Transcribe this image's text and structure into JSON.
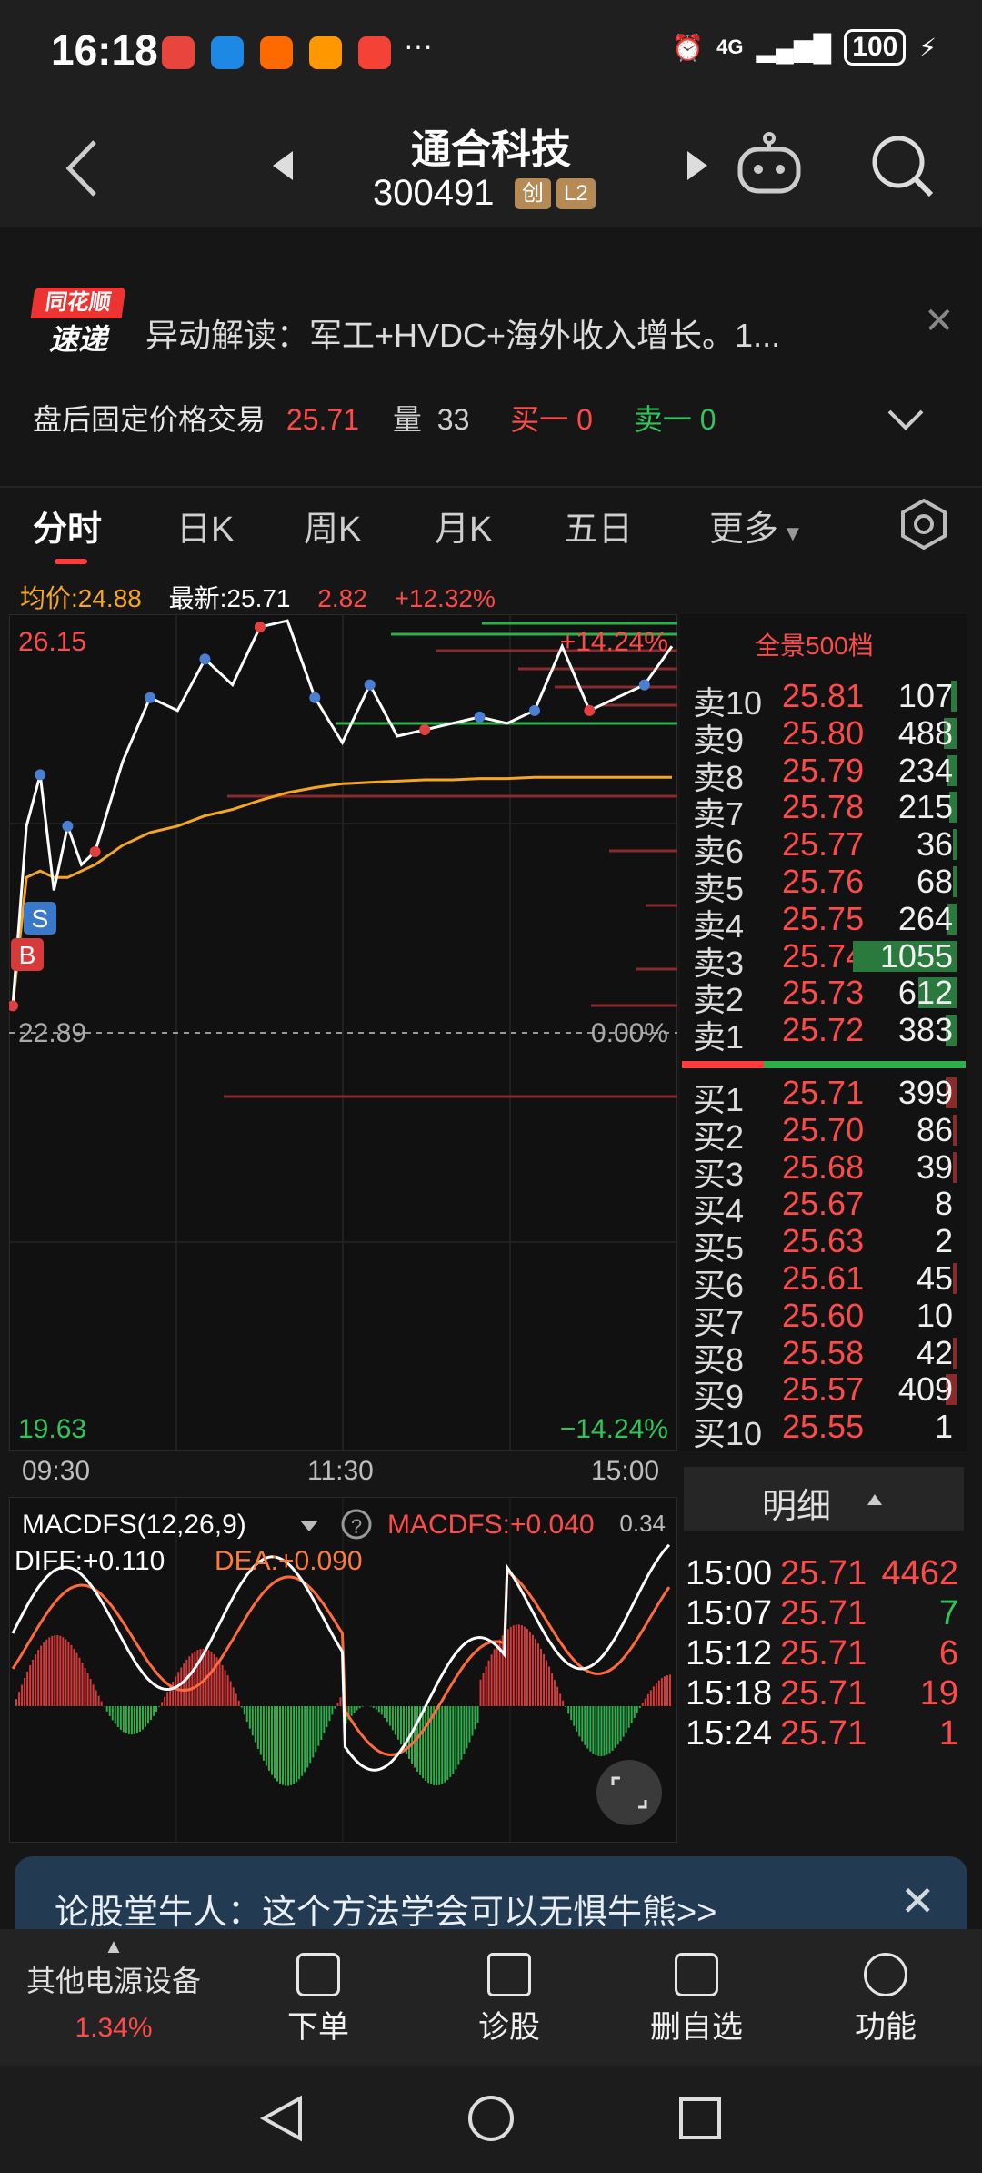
{
  "status": {
    "time": "16:18",
    "network": "4G",
    "battery": "100",
    "more": "···"
  },
  "header": {
    "name": "通合科技",
    "code": "300491",
    "tag1": "创",
    "tag2": "L2"
  },
  "news": {
    "logo_top": "同花顺",
    "logo_bottom": "速递",
    "text": "异动解读：军工+HVDC+海外收入增长。1..."
  },
  "after_hours": {
    "label": "盘后固定价格交易",
    "price": "25.71",
    "vol_label": "量",
    "vol": "33",
    "buy1": "买一 0",
    "sell1": "卖一 0"
  },
  "tabs": [
    {
      "label": "分时"
    },
    {
      "label": "日K"
    },
    {
      "label": "周K"
    },
    {
      "label": "月K"
    },
    {
      "label": "五日"
    },
    {
      "label": "更多"
    }
  ],
  "info": {
    "avg": "均价:24.88",
    "latest": "最新:25.71",
    "change": "2.82",
    "pct": "+12.32%"
  },
  "chart_labels": {
    "high": "26.15",
    "high_pct": "+14.24%",
    "base": "22.89",
    "base_pct": "0.00%",
    "low": "19.63",
    "low_pct": "−14.24%",
    "t1": "09:30",
    "t2": "11:30",
    "t3": "15:00",
    "marker_b": "B",
    "marker_s": "S"
  },
  "macd": {
    "title": "MACDFS(12,26,9)",
    "value": "MACDFS:+0.040",
    "diff": "DIFF:+0.110",
    "dea": "DEA:+0.090",
    "scale": "0.34"
  },
  "chart_data": {
    "type": "line",
    "xlabel": "",
    "ylabel": "",
    "x": [
      0,
      5,
      10,
      15,
      20,
      25,
      30,
      40,
      50,
      60,
      70,
      80,
      90,
      100,
      110,
      120,
      130,
      140,
      150,
      160,
      170,
      180,
      190,
      200,
      210,
      220,
      230,
      240
    ],
    "series": [
      {
        "values": [
          23.1,
          24.5,
          24.9,
          24.0,
          24.5,
          24.2,
          24.3,
          25.0,
          25.5,
          25.4,
          25.8,
          25.6,
          26.05,
          26.1,
          25.5,
          25.15,
          25.6,
          25.2,
          25.25,
          25.3,
          25.35,
          25.3,
          25.4,
          25.9,
          25.4,
          25.5,
          25.6,
          25.9
        ]
      },
      {
        "values": [
          23.1,
          24.1,
          24.15,
          24.1,
          24.1,
          24.15,
          24.2,
          24.35,
          24.45,
          24.5,
          24.58,
          24.63,
          24.7,
          24.76,
          24.8,
          24.83,
          24.84,
          24.85,
          24.86,
          24.86,
          24.87,
          24.87,
          24.88,
          24.88,
          24.88,
          24.88,
          24.88,
          24.88
        ]
      }
    ],
    "ylim": [
      19.63,
      26.15
    ],
    "base": 22.89,
    "grid": true
  },
  "orderbook": {
    "title": "全景500档",
    "asks": [
      {
        "label": "卖10",
        "price": "25.81",
        "vol": "107",
        "bar": 0.05
      },
      {
        "label": "卖9",
        "price": "25.80",
        "vol": "488",
        "bar": 0.12
      },
      {
        "label": "卖8",
        "price": "25.79",
        "vol": "234",
        "bar": 0.08
      },
      {
        "label": "卖7",
        "price": "25.78",
        "vol": "215",
        "bar": 0.07
      },
      {
        "label": "卖6",
        "price": "25.77",
        "vol": "36",
        "bar": 0.02
      },
      {
        "label": "卖5",
        "price": "25.76",
        "vol": "68",
        "bar": 0.03
      },
      {
        "label": "卖4",
        "price": "25.75",
        "vol": "264",
        "bar": 0.08
      },
      {
        "label": "卖3",
        "price": "25.74",
        "vol": "1055",
        "bar": 0.95
      },
      {
        "label": "卖2",
        "price": "25.73",
        "vol": "612",
        "bar": 0.35
      },
      {
        "label": "卖1",
        "price": "25.72",
        "vol": "383",
        "bar": 0.1
      }
    ],
    "bids": [
      {
        "label": "买1",
        "price": "25.71",
        "vol": "399",
        "bar": 0.1
      },
      {
        "label": "买2",
        "price": "25.70",
        "vol": "86",
        "bar": 0.02
      },
      {
        "label": "买3",
        "price": "25.68",
        "vol": "39",
        "bar": 0.01
      },
      {
        "label": "买4",
        "price": "25.67",
        "vol": "8",
        "bar": 0.0
      },
      {
        "label": "买5",
        "price": "25.63",
        "vol": "2",
        "bar": 0.0
      },
      {
        "label": "买6",
        "price": "25.61",
        "vol": "45",
        "bar": 0.01
      },
      {
        "label": "买7",
        "price": "25.60",
        "vol": "10",
        "bar": 0.0
      },
      {
        "label": "买8",
        "price": "25.58",
        "vol": "42",
        "bar": 0.01
      },
      {
        "label": "买9",
        "price": "25.57",
        "vol": "409",
        "bar": 0.1
      },
      {
        "label": "买10",
        "price": "25.55",
        "vol": "1",
        "bar": 0.0
      }
    ]
  },
  "detail": {
    "title": "明细",
    "trades": [
      {
        "time": "15:00",
        "price": "25.71",
        "vol": "4462",
        "color": "red"
      },
      {
        "time": "15:07",
        "price": "25.71",
        "vol": "7",
        "color": "green"
      },
      {
        "time": "15:12",
        "price": "25.71",
        "vol": "6",
        "color": "red"
      },
      {
        "time": "15:18",
        "price": "25.71",
        "vol": "19",
        "color": "red"
      },
      {
        "time": "15:24",
        "price": "25.71",
        "vol": "1",
        "color": "red"
      }
    ]
  },
  "banner": {
    "text": "论股堂牛人：这个方法学会可以无惧牛熊>>"
  },
  "toolbar": {
    "sector": "其他电源设备",
    "sector_pct": "1.34%",
    "order": "下单",
    "diagnose": "诊股",
    "remove": "删自选",
    "function": "功能"
  },
  "colors": {
    "up": "#ff4a4a",
    "down": "#32c35a",
    "price_line": "#ffffff",
    "avg_line": "#f5a623"
  }
}
